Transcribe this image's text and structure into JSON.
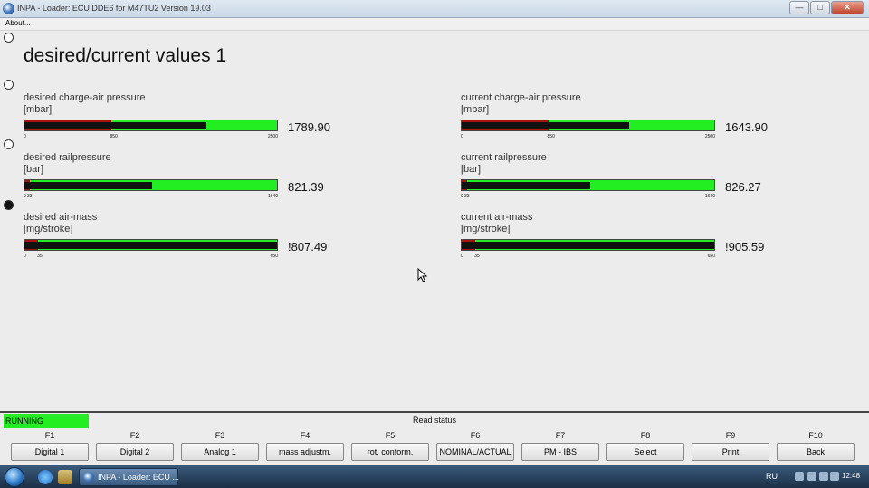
{
  "window": {
    "title": "INPA - Loader:  ECU DDE6 for M47TU2 Version 19.03"
  },
  "menu": {
    "about": "About..."
  },
  "screen": {
    "title": "desired/current values 1"
  },
  "gauges": {
    "desired_charge_air": {
      "label": "desired charge-air pressure",
      "unit": "[mbar]",
      "value_text": "1789.90",
      "value": 1789.9,
      "min": 0,
      "max": 2500,
      "threshold": 850,
      "min_label": "0",
      "threshold_label": "850",
      "max_label": "2500"
    },
    "current_charge_air": {
      "label": "current charge-air pressure",
      "unit": "[mbar]",
      "value_text": "1643.90",
      "value": 1643.9,
      "min": 0,
      "max": 2500,
      "threshold": 850,
      "min_label": "0",
      "threshold_label": "850",
      "max_label": "2500"
    },
    "desired_rail": {
      "label": "desired railpressure",
      "unit": "[bar]",
      "value_text": "821.39",
      "value": 821.39,
      "min": 0,
      "max": 1640,
      "threshold": 33,
      "min_label": "0",
      "threshold_label": "33",
      "max_label": "1640"
    },
    "current_rail": {
      "label": "current railpressure",
      "unit": "[bar]",
      "value_text": "826.27",
      "value": 826.27,
      "min": 0,
      "max": 1640,
      "threshold": 33,
      "min_label": "0",
      "threshold_label": "33",
      "max_label": "1640"
    },
    "desired_air_mass": {
      "label": "desired air-mass",
      "unit": "[mg/stroke]",
      "value_text": "!807.49",
      "value": 650,
      "min": 0,
      "max": 650,
      "threshold": 35,
      "min_label": "0",
      "threshold_label": "35",
      "max_label": "650"
    },
    "current_air_mass": {
      "label": "current air-mass",
      "unit": "[mg/stroke]",
      "value_text": "!905.59",
      "value": 650,
      "min": 0,
      "max": 650,
      "threshold": 35,
      "min_label": "0",
      "threshold_label": "35",
      "max_label": "650"
    }
  },
  "colors": {
    "bar_ok": "#22ee22",
    "bar_low": "#aa1111",
    "bar_value": "#111111",
    "status_running": "#22ee22"
  },
  "status": {
    "running": "RUNNING",
    "read_status": "Read status"
  },
  "fkeys": [
    {
      "key": "F1",
      "label": "Digital 1"
    },
    {
      "key": "F2",
      "label": "Digital 2"
    },
    {
      "key": "F3",
      "label": "Analog 1"
    },
    {
      "key": "F4",
      "label": "mass adjustm."
    },
    {
      "key": "F5",
      "label": "rot. conform."
    },
    {
      "key": "F6",
      "label": "NOMINAL/ACTUAL"
    },
    {
      "key": "F7",
      "label": "PM - IBS"
    },
    {
      "key": "F8",
      "label": "Select"
    },
    {
      "key": "F9",
      "label": "Print"
    },
    {
      "key": "F10",
      "label": "Back"
    }
  ],
  "taskbar": {
    "app_title": "INPA - Loader:  ECU ...",
    "language": "RU",
    "clock": "12:48"
  }
}
